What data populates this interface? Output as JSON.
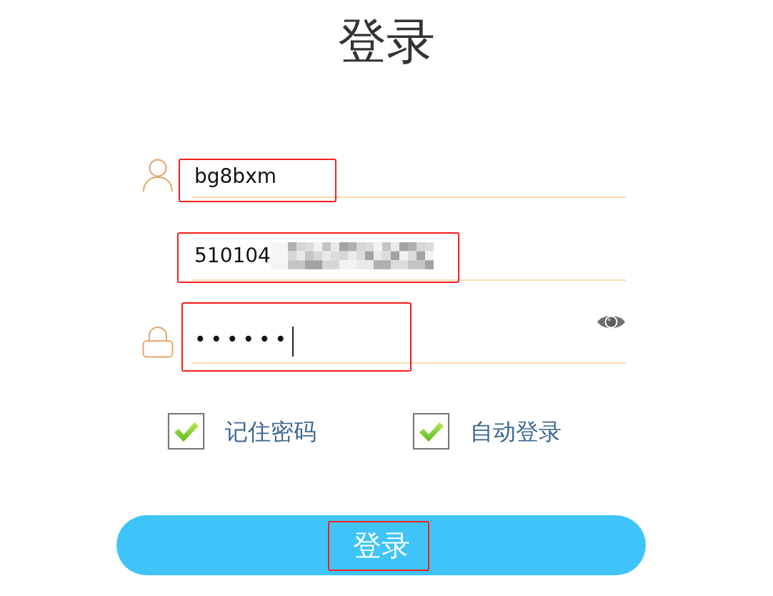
{
  "title": "登录",
  "fields": [
    {
      "kind": "username",
      "value": "bg8bxm",
      "redacted": false,
      "focused": false,
      "highlighted": true
    },
    {
      "kind": "id",
      "value": "510104",
      "redacted": true,
      "focused": false,
      "highlighted": true
    },
    {
      "kind": "password",
      "value": "••••••",
      "redacted": false,
      "focused": true,
      "highlighted": true
    }
  ],
  "options": [
    {
      "label": "记住密码",
      "checked": true
    },
    {
      "label": "自动登录",
      "checked": true
    }
  ],
  "login_button": {
    "label": "登录",
    "highlighted": true
  }
}
